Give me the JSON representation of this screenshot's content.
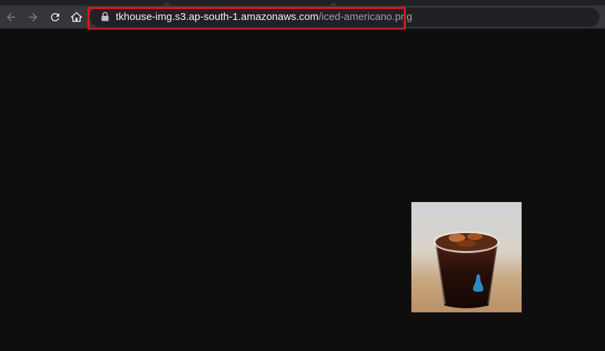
{
  "browser": {
    "url": {
      "host": "tkhouse-img.s3.ap-south-1.amazonaws.com",
      "path": "/iced-americano.png"
    },
    "highlight_color": "#e0151e",
    "icons": [
      "back-arrow-icon",
      "forward-arrow-icon",
      "reload-icon",
      "home-icon",
      "lock-icon"
    ]
  },
  "content": {
    "image_subject": "iced-americano",
    "background": "#0e0e0e"
  }
}
